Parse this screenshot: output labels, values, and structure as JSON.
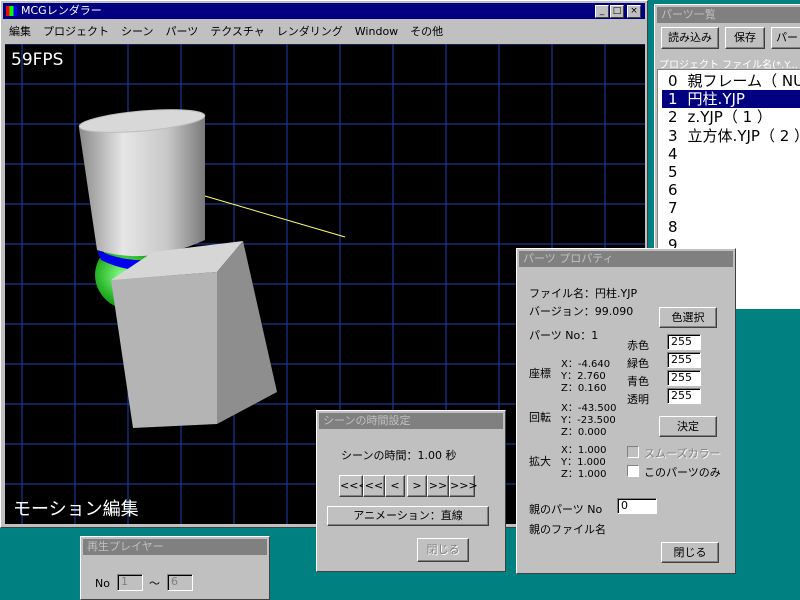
{
  "main_window": {
    "title": "MCGレンダラー",
    "menu": [
      "編集",
      "プロジェクト",
      "シーン",
      "パーツ",
      "テクスチャ",
      "レンダリング",
      "Window",
      "その他"
    ],
    "fps": "59FPS",
    "mode_label": "モーション編集",
    "controls": {
      "minimize": "_",
      "maximize": "□",
      "close": "×"
    }
  },
  "parts_list": {
    "title": "パーツ一覧",
    "buttons": {
      "load": "読み込み",
      "save": "保存",
      "parts": "パー"
    },
    "header": "プロジェクト ファイル名(*.Y...",
    "items": [
      {
        "no": "0",
        "name": "親フレーム（ NU"
      },
      {
        "no": "1",
        "name": "円柱.YJP"
      },
      {
        "no": "2",
        "name": "z.YJP（ 1 ）"
      },
      {
        "no": "3",
        "name": "立方体.YJP（ 2 ）"
      },
      {
        "no": "4",
        "name": ""
      },
      {
        "no": "5",
        "name": ""
      },
      {
        "no": "6",
        "name": ""
      },
      {
        "no": "7",
        "name": ""
      },
      {
        "no": "8",
        "name": ""
      },
      {
        "no": "9",
        "name": ""
      }
    ],
    "selected_index": 1
  },
  "properties": {
    "title": "パーツ プロパティ",
    "file_label": "ファイル名：円柱.YJP",
    "version_label": "バージョン：99.090",
    "color_button": "色選択",
    "parts_no_label": "パーツ No：1",
    "position_label": "座標",
    "position": [
      "X：-4.640",
      "Y：2.760",
      "Z：0.160"
    ],
    "rotation_label": "回転",
    "rotation": [
      "X：-43.500",
      "Y：-23.500",
      "Z：0.000"
    ],
    "scale_label": "拡大",
    "scale": [
      "X：1.000",
      "Y：1.000",
      "Z：1.000"
    ],
    "red_label": "赤色",
    "red_value": "255",
    "green_label": "緑色",
    "green_value": "255",
    "blue_label": "青色",
    "blue_value": "255",
    "alpha_label": "透明",
    "alpha_value": "255",
    "apply_button": "決定",
    "smooth_color_label": "スムーズカラー",
    "this_part_only_label": "このパーツのみ",
    "parent_parts_label": "親のパーツ No",
    "parent_parts_value": "0",
    "parent_file_label": "親のファイル名",
    "close_button": "閉じる"
  },
  "scene_time": {
    "title": "シーンの時間設定",
    "time_label": "シーンの時間：1.00 秒",
    "nav_buttons": [
      "<<<",
      "<<",
      "<",
      ">",
      ">>",
      ">>>"
    ],
    "animation_button": "アニメーション：直線",
    "close_button": "閉じる"
  },
  "player": {
    "title": "再生プレイヤー",
    "no_label": "No",
    "from_value": "1",
    "tilde": "〜",
    "to_value": "6"
  },
  "colors": {
    "desktop": "#008080",
    "active_title": "#000080",
    "inactive_title": "#808080",
    "viewport_bg": "#000000",
    "grid": "#1f3fb0"
  }
}
